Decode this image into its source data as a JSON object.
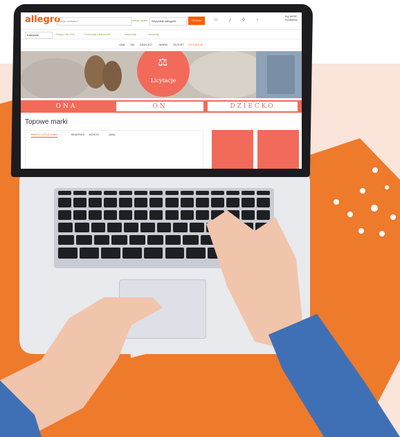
{
  "colors": {
    "brand_orange": "#ff5a00",
    "coral": "#f26a5a",
    "bg_orange": "#ee7a2c",
    "bg_peach": "#fbe4da",
    "laptop_dark": "#1c1c1e",
    "laptop_silver": "#e8eaee"
  },
  "header": {
    "logo": "allegro",
    "search_placeholder": "czego szukasz?",
    "search_option": "szukaj ustaw",
    "category_select": "Wszystkie kategorie",
    "search_button": "SZUKAJ",
    "user_line1": "Hej! WIRE?",
    "user_line2": "Ronaldinho",
    "icons": [
      "star-icon",
      "bell-icon",
      "cart-icon",
      "bag-icon",
      "user-icon"
    ]
  },
  "nav": {
    "category_select": "Kategorie",
    "links": [
      "Okazja dla 70%",
      "Promocja z Biedronki",
      "Inspiracje",
      "Sprzedaj"
    ]
  },
  "tabs": [
    "ONA",
    "ON",
    "DZIECKO",
    "MARKI",
    "OUTLET",
    "LICYTACJE"
  ],
  "hero": {
    "label": "Licytacje",
    "icon": "gavel-icon"
  },
  "segments": [
    "ONA",
    "ON",
    "DZIECKO"
  ],
  "section_title": "Topowe marki",
  "brand_tabs": [
    "PRETTY LITTLE THING",
    "RESERVED",
    "MOHITO",
    "ZARA"
  ]
}
